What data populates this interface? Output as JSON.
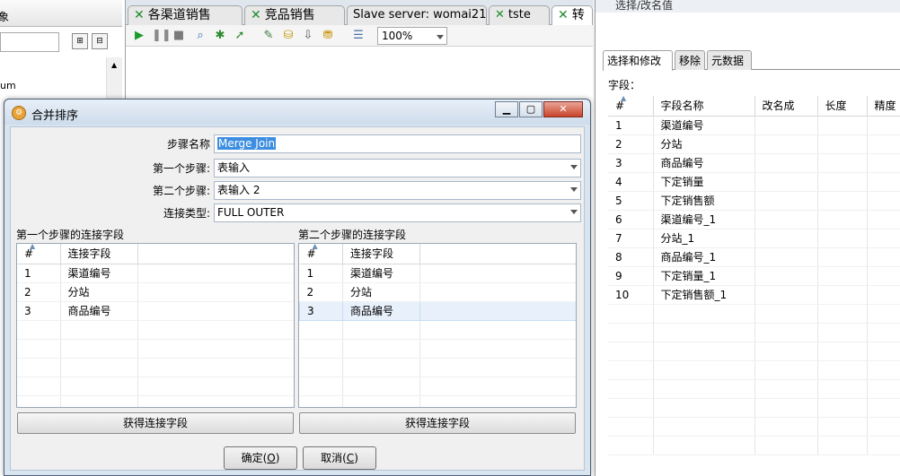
{
  "explorer": {
    "title_fragment": "象",
    "list_item": "um"
  },
  "tabs": [
    {
      "label": "各渠道销售",
      "icon": "transformation-icon"
    },
    {
      "label": "竞品销售",
      "icon": "transformation-icon"
    },
    {
      "label": "Slave server: womai21",
      "icon": ""
    },
    {
      "label": "tste",
      "icon": "transformation-icon"
    },
    {
      "label": "转",
      "icon": "transformation-icon"
    }
  ],
  "toolbar": {
    "zoom": "100%"
  },
  "right_panel": {
    "title": "选择/改名值",
    "tabs": [
      "选择和修改",
      "移除",
      "元数据"
    ],
    "fields_label": "字段：",
    "columns": [
      "#",
      "字段名称",
      "改名成",
      "长度",
      "精度"
    ],
    "rows": [
      [
        "1",
        "渠道编号"
      ],
      [
        "2",
        "分站"
      ],
      [
        "3",
        "商品编号"
      ],
      [
        "4",
        "下定销量"
      ],
      [
        "5",
        "下定销售额"
      ],
      [
        "6",
        "渠道编号_1"
      ],
      [
        "7",
        "分站_1"
      ],
      [
        "8",
        "商品编号_1"
      ],
      [
        "9",
        "下定销量_1"
      ],
      [
        "10",
        "下定销售额_1"
      ]
    ]
  },
  "dialog": {
    "title": "合并排序",
    "step_name_label": "步骤名称",
    "step_name_value": "Merge Join",
    "first_step_label": "第一个步骤:",
    "first_step_value": "表输入",
    "second_step_label": "第二个步骤:",
    "second_step_value": "表输入 2",
    "join_type_label": "连接类型:",
    "join_type_value": "FULL OUTER",
    "left_section_label": "第一个步骤的连接字段",
    "right_section_label": "第二个步骤的连接字段",
    "grid_columns": [
      "#",
      "连接字段"
    ],
    "left_rows": [
      [
        "1",
        "渠道编号"
      ],
      [
        "2",
        "分站"
      ],
      [
        "3",
        "商品编号"
      ]
    ],
    "right_rows": [
      [
        "1",
        "渠道编号"
      ],
      [
        "2",
        "分站"
      ],
      [
        "3",
        "商品编号"
      ]
    ],
    "get_fields_label": "获得连接字段",
    "ok_label": "确定(",
    "ok_key": "O",
    "ok_suffix": ")",
    "cancel_label": "取消(",
    "cancel_key": "C",
    "cancel_suffix": ")"
  }
}
